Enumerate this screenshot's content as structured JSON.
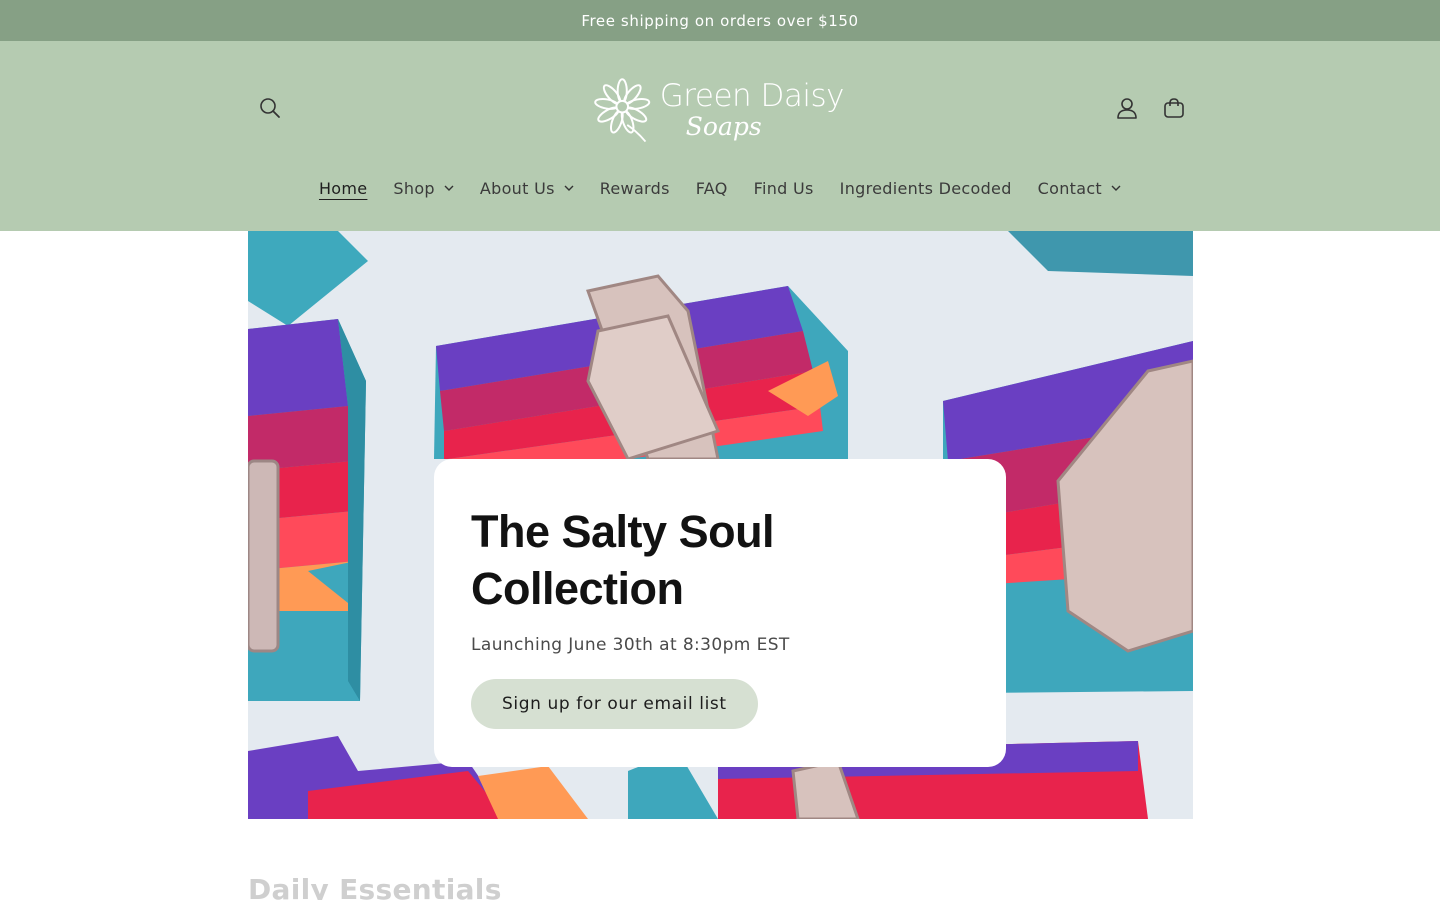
{
  "announcement": {
    "text": "Free shipping on orders over $150"
  },
  "header": {
    "logo_line1": "Green Daisy",
    "logo_line2": "Soaps",
    "icons": {
      "search": "search-icon",
      "account": "user-icon",
      "cart": "cart-icon"
    }
  },
  "nav": {
    "items": [
      {
        "label": "Home",
        "active": true,
        "dropdown": false
      },
      {
        "label": "Shop",
        "active": false,
        "dropdown": true
      },
      {
        "label": "About Us",
        "active": false,
        "dropdown": true
      },
      {
        "label": "Rewards",
        "active": false,
        "dropdown": false
      },
      {
        "label": "FAQ",
        "active": false,
        "dropdown": false
      },
      {
        "label": "Find Us",
        "active": false,
        "dropdown": false
      },
      {
        "label": "Ingredients Decoded",
        "active": false,
        "dropdown": false
      },
      {
        "label": "Contact",
        "active": false,
        "dropdown": true
      }
    ]
  },
  "hero": {
    "title": "The Salty Soul Collection",
    "subtitle": "Launching June 30th at 8:30pm EST",
    "button_label": "Sign up for our email list"
  },
  "next_section": {
    "heading": "Daily Essentials"
  },
  "colors": {
    "announcement_bg": "#86a085",
    "header_bg": "#b5cbb1",
    "button_bg": "#d6e0d2"
  }
}
